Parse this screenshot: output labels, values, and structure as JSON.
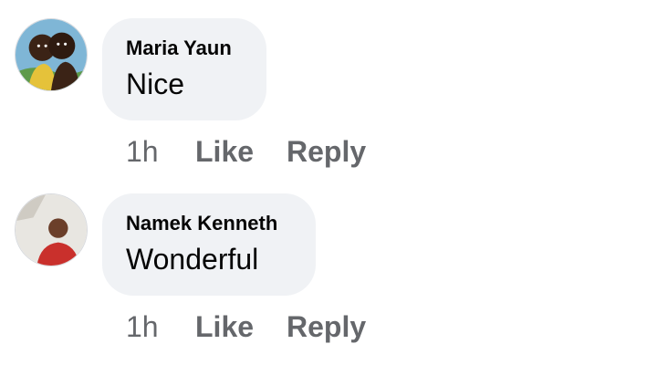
{
  "comments": [
    {
      "author": "Maria Yaun",
      "text": "Nice",
      "time": "1h",
      "like_label": "Like",
      "reply_label": "Reply"
    },
    {
      "author": "Namek Kenneth",
      "text": "Wonderful",
      "time": "1h",
      "like_label": "Like",
      "reply_label": "Reply"
    }
  ],
  "colors": {
    "bubble_bg": "#f0f2f5",
    "name_text": "#050505",
    "meta_text": "#65676b"
  }
}
